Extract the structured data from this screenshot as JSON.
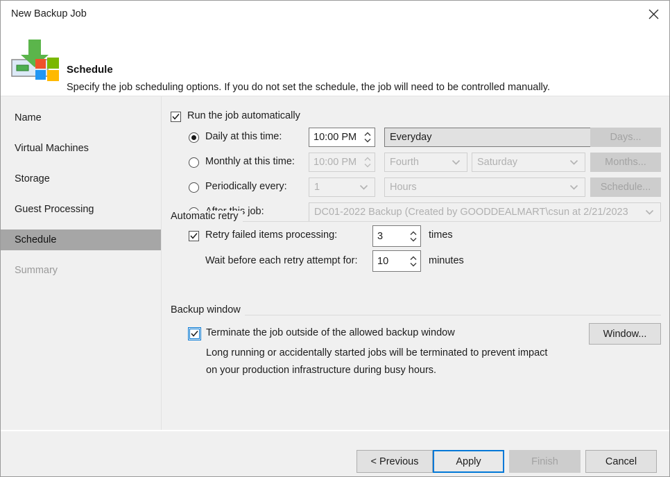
{
  "window": {
    "title": "New Backup Job",
    "close_icon": "close-icon"
  },
  "header": {
    "icon": "backup-job-windows-icon",
    "title": "Schedule",
    "description": "Specify the job scheduling options. If you do not set the schedule, the job will need to be controlled manually."
  },
  "sidebar": {
    "items": [
      {
        "label": "Name",
        "state": "normal"
      },
      {
        "label": "Virtual Machines",
        "state": "normal"
      },
      {
        "label": "Storage",
        "state": "normal"
      },
      {
        "label": "Guest Processing",
        "state": "normal"
      },
      {
        "label": "Schedule",
        "state": "selected"
      },
      {
        "label": "Summary",
        "state": "disabled"
      }
    ]
  },
  "main": {
    "run_automatically": {
      "label": "Run the job automatically",
      "checked": true
    },
    "schedule_options": {
      "daily": {
        "label": "Daily at this time:",
        "selected": true,
        "time_value": "10:00 PM",
        "days_value": "Everyday",
        "button_label": "Days...",
        "button_disabled": true
      },
      "monthly": {
        "label": "Monthly at this time:",
        "selected": false,
        "time_value": "10:00 PM",
        "ordinal_value": "Fourth",
        "weekday_value": "Saturday",
        "button_label": "Months...",
        "button_disabled": true
      },
      "periodically": {
        "label": "Periodically every:",
        "selected": false,
        "interval_value": "1",
        "unit_value": "Hours",
        "button_label": "Schedule...",
        "button_disabled": true
      },
      "after_job": {
        "label": "After this job:",
        "selected": false,
        "job_value": "DC01-2022 Backup (Created by GOODDEALMART\\csun at 2/21/2023"
      }
    },
    "automatic_retry": {
      "group_label": "Automatic retry",
      "retry_checkbox_label": "Retry failed items processing:",
      "retry_checked": true,
      "retry_times_value": "3",
      "retry_times_suffix": "times",
      "wait_label": "Wait before each retry attempt for:",
      "wait_value": "10",
      "wait_suffix": "minutes"
    },
    "backup_window": {
      "group_label": "Backup window",
      "terminate_label": "Terminate the job outside of the allowed backup window",
      "terminate_checked": true,
      "terminate_focused": true,
      "description_line1": "Long running or accidentally started jobs will be terminated to prevent impact",
      "description_line2": "on your production infrastructure during busy hours.",
      "window_button_label": "Window..."
    }
  },
  "footer": {
    "previous_label": "< Previous",
    "apply_label": "Apply",
    "finish_label": "Finish",
    "finish_disabled": true,
    "cancel_label": "Cancel"
  },
  "colors": {
    "accent": "#0078d7",
    "selected_sidebar": "#a6a6a6",
    "panel": "#f0f0f0"
  }
}
